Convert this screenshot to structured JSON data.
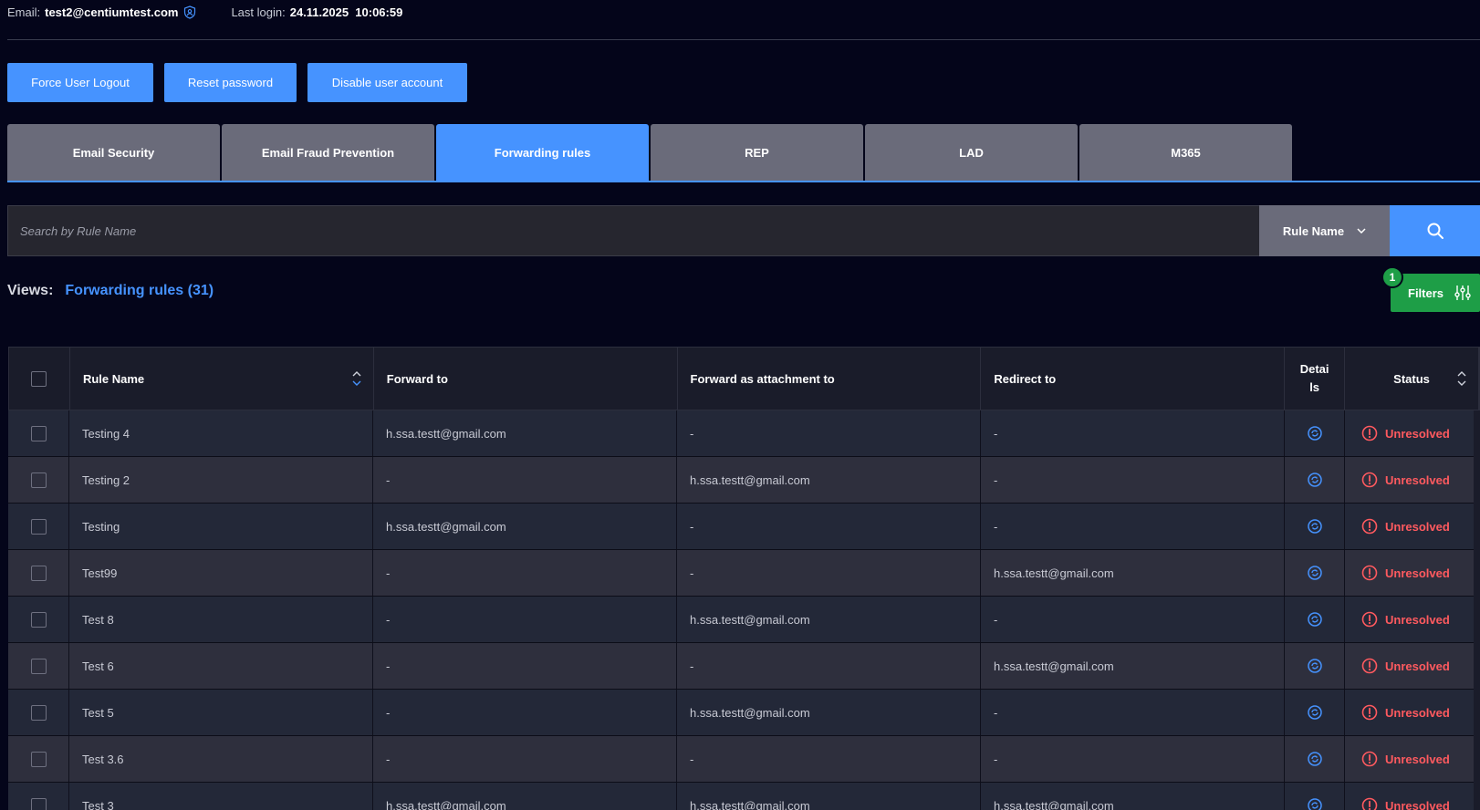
{
  "header": {
    "email_label": "Email:",
    "email_value": "test2@centiumtest.com",
    "last_login_label": "Last login:",
    "last_login_value": "24.11.2025  10:06:59"
  },
  "actions": {
    "force_logout": "Force User Logout",
    "reset_password": "Reset password",
    "disable_account": "Disable user account"
  },
  "tabs": [
    {
      "label": "Email Security",
      "active": false
    },
    {
      "label": "Email Fraud Prevention",
      "active": false
    },
    {
      "label": "Forwarding rules",
      "active": true
    },
    {
      "label": "REP",
      "active": false
    },
    {
      "label": "LAD",
      "active": false
    },
    {
      "label": "M365",
      "active": false
    }
  ],
  "search": {
    "placeholder": "Search by Rule Name",
    "value": "",
    "field_select": "Rule Name"
  },
  "views": {
    "label": "Views:",
    "current": "Forwarding rules (31)"
  },
  "filters": {
    "label": "Filters",
    "count": "1"
  },
  "table": {
    "headers": {
      "rule_name": "Rule Name",
      "forward_to": "Forward to",
      "forward_attachment": "Forward as attachment to",
      "redirect_to": "Redirect to",
      "details": "Detai ls",
      "status": "Status"
    },
    "rows": [
      {
        "name": "Testing 4",
        "forward_to": "h.ssa.testt@gmail.com",
        "attachment": "-",
        "redirect": "-",
        "status": "Unresolved"
      },
      {
        "name": "Testing 2",
        "forward_to": "-",
        "attachment": "h.ssa.testt@gmail.com",
        "redirect": "-",
        "status": "Unresolved"
      },
      {
        "name": "Testing",
        "forward_to": "h.ssa.testt@gmail.com",
        "attachment": "-",
        "redirect": "-",
        "status": "Unresolved"
      },
      {
        "name": "Test99",
        "forward_to": "-",
        "attachment": "-",
        "redirect": "h.ssa.testt@gmail.com",
        "status": "Unresolved"
      },
      {
        "name": "Test 8",
        "forward_to": "-",
        "attachment": "h.ssa.testt@gmail.com",
        "redirect": "-",
        "status": "Unresolved"
      },
      {
        "name": "Test 6",
        "forward_to": "-",
        "attachment": "-",
        "redirect": "h.ssa.testt@gmail.com",
        "status": "Unresolved"
      },
      {
        "name": "Test 5",
        "forward_to": "-",
        "attachment": "h.ssa.testt@gmail.com",
        "redirect": "-",
        "status": "Unresolved"
      },
      {
        "name": "Test 3.6",
        "forward_to": "-",
        "attachment": "-",
        "redirect": "-",
        "status": "Unresolved"
      },
      {
        "name": "Test 3",
        "forward_to": "h.ssa.testt@gmail.com",
        "attachment": "h.ssa.testt@gmail.com",
        "redirect": "h.ssa.testt@gmail.com",
        "status": "Unresolved"
      }
    ]
  },
  "colors": {
    "background": "#04051a",
    "accent": "#4693ff",
    "tab_inactive": "#6a6b7a",
    "filters_green": "#1e9e47",
    "status_red": "#ff5a5f"
  },
  "icons": {
    "shield": "shield-user-icon",
    "search": "search-icon",
    "chevron": "chevron-down-icon",
    "filters": "sliders-icon",
    "details": "details-circle-icon",
    "status": "alert-circle-icon",
    "sort": "sort-icon"
  }
}
